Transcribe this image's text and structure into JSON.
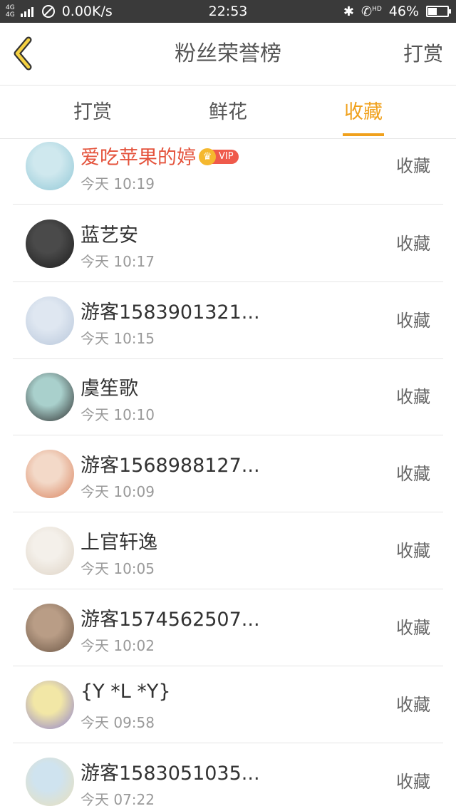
{
  "status_bar": {
    "network": "4G 4G",
    "speed": "0.00K/s",
    "time": "22:53",
    "bluetooth_icon": "bluetooth-icon",
    "hd": "HD",
    "battery": "46%",
    "battery_level": 0.46
  },
  "nav": {
    "title": "粉丝荣誉榜",
    "action": "打赏"
  },
  "tabs": [
    {
      "label": "打赏",
      "active": false
    },
    {
      "label": "鲜花",
      "active": false
    },
    {
      "label": "收藏",
      "active": true
    }
  ],
  "colors": {
    "accent": "#f0a11d",
    "vip_name": "#e4523b",
    "status_bar_bg": "#3a3a3a"
  },
  "vip_badge": {
    "label": "VIP"
  },
  "rows": [
    {
      "name": "爱吃苹果的婷",
      "time": "今天 10:19",
      "action": "收藏",
      "vip": true,
      "avatar_colors": [
        "#cfe8ee",
        "#8fc7d6"
      ]
    },
    {
      "name": "蓝艺安",
      "time": "今天 10:17",
      "action": "收藏",
      "vip": false,
      "avatar_colors": [
        "#4a4a4a",
        "#1c1c1c"
      ]
    },
    {
      "name": "游客1583901321...",
      "time": "今天 10:15",
      "action": "收藏",
      "vip": false,
      "avatar_colors": [
        "#dfe7f1",
        "#b7c6da"
      ]
    },
    {
      "name": "虞笙歌",
      "time": "今天 10:10",
      "action": "收藏",
      "vip": false,
      "avatar_colors": [
        "#a9d0cc",
        "#2b2b2b"
      ]
    },
    {
      "name": "游客1568988127...",
      "time": "今天 10:09",
      "action": "收藏",
      "vip": false,
      "avatar_colors": [
        "#f3d9c8",
        "#d9815c"
      ]
    },
    {
      "name": "上官轩逸",
      "time": "今天 10:05",
      "action": "收藏",
      "vip": false,
      "avatar_colors": [
        "#f4f0ea",
        "#ddd2c4"
      ]
    },
    {
      "name": "游客1574562507...",
      "time": "今天 10:02",
      "action": "收藏",
      "vip": false,
      "avatar_colors": [
        "#b99d86",
        "#6a5544"
      ]
    },
    {
      "name": "{Y *L *Y}",
      "time": "今天 09:58",
      "action": "收藏",
      "vip": false,
      "avatar_colors": [
        "#f2e7a6",
        "#8c7fd0"
      ]
    },
    {
      "name": "游客1583051035...",
      "time": "今天 07:22",
      "action": "收藏",
      "vip": false,
      "avatar_colors": [
        "#cfe3ef",
        "#e9dfb9"
      ]
    }
  ]
}
